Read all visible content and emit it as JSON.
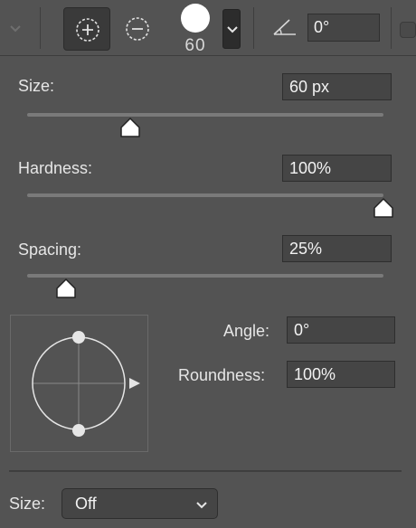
{
  "toolbar": {
    "brush_tip_size": "60",
    "angle_value": "0°"
  },
  "settings": {
    "size": {
      "label": "Size:",
      "value": "60 px",
      "slider_fraction": 0.29
    },
    "hardness": {
      "label": "Hardness:",
      "value": "100%",
      "slider_fraction": 1.0
    },
    "spacing": {
      "label": "Spacing:",
      "value": "25%",
      "slider_fraction": 0.11
    },
    "angle": {
      "label": "Angle:",
      "value": "0°"
    },
    "roundness": {
      "label": "Roundness:",
      "value": "100%"
    }
  },
  "dynamics": {
    "size_label": "Size:",
    "size_control": "Off"
  },
  "icons": [
    "chevron-down-icon",
    "add-brush-icon",
    "subtract-brush-icon",
    "brush-tip-icon",
    "angle-icon"
  ]
}
